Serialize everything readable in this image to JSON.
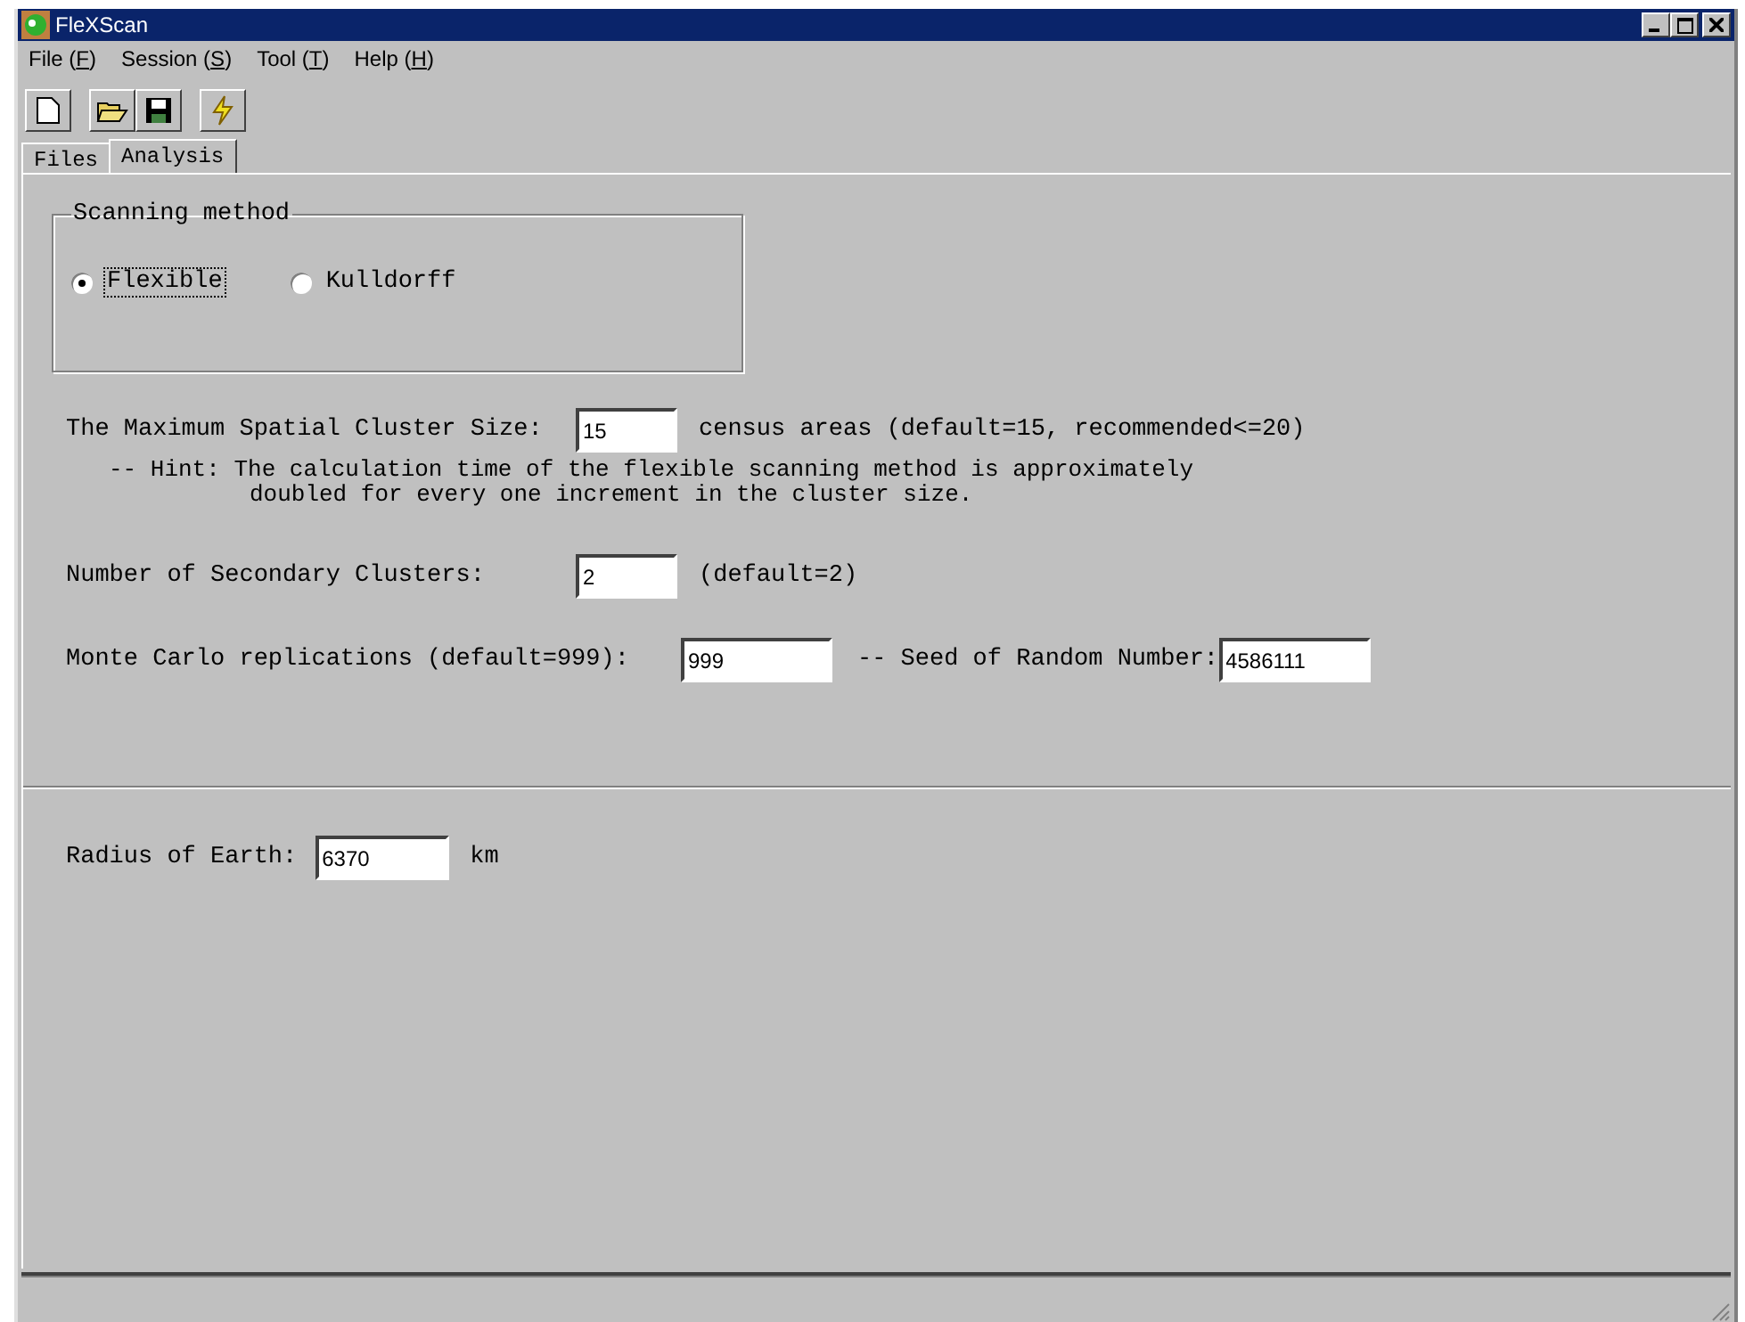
{
  "window": {
    "title": "FleXScan"
  },
  "menu": [
    {
      "before": "File (",
      "key": "F",
      "after": ")"
    },
    {
      "before": "Session (",
      "key": "S",
      "after": ")"
    },
    {
      "before": "Tool (",
      "key": "T",
      "after": ")"
    },
    {
      "before": "Help (",
      "key": "H",
      "after": ")"
    }
  ],
  "tabs": [
    {
      "label": "Files",
      "selected": false
    },
    {
      "label": "Analysis",
      "selected": true
    }
  ],
  "scanning_method": {
    "title": "Scanning method",
    "options": [
      {
        "label": "Flexible",
        "selected": true
      },
      {
        "label": "Kulldorff",
        "selected": false
      }
    ]
  },
  "max_cluster_size": {
    "label": "The Maximum Spatial Cluster Size:",
    "value": "15",
    "note": "census areas (default=15, recommended<=20)"
  },
  "hint": [
    "-- Hint: The calculation time of the flexible scanning method is approximately",
    "doubled for every one increment in the cluster size."
  ],
  "secondary_clusters": {
    "label": "Number of Secondary Clusters:",
    "value": "2",
    "note": "(default=2)"
  },
  "monte_carlo": {
    "label": "Monte Carlo replications (default=999):",
    "value": "999"
  },
  "seed": {
    "label": "-- Seed of Random Number:",
    "value": "4586111"
  },
  "radius": {
    "label": "Radius of Earth:",
    "value": "6370",
    "unit": "km"
  }
}
